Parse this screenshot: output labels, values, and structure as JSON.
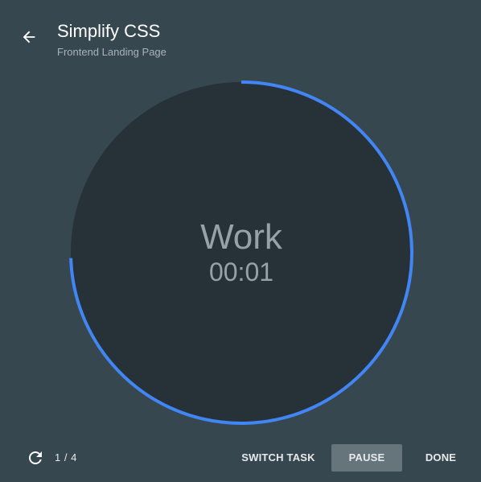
{
  "header": {
    "back_icon": "arrow-left-icon",
    "title": "Simplify CSS",
    "subtitle": "Frontend Landing Page"
  },
  "timer": {
    "phase": "Work",
    "time": "00:01",
    "progress_fraction": 0.745,
    "colors": {
      "ring": "#4285f4",
      "dial": "#263238",
      "background": "#37474f"
    }
  },
  "footer": {
    "reset_icon": "refresh-icon",
    "round_counter": "1 / 4",
    "switch_task_label": "SWITCH TASK",
    "pause_label": "PAUSE",
    "done_label": "DONE"
  }
}
